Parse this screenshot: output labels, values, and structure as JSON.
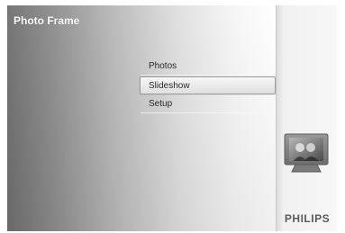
{
  "app": {
    "title": "Photo Frame"
  },
  "menu": {
    "items": [
      {
        "label": "Photos",
        "selected": false
      },
      {
        "label": "Slideshow",
        "selected": true
      },
      {
        "label": "Setup",
        "selected": false
      }
    ]
  },
  "side_panel": {
    "icon": "photo-frame-icon",
    "brand": "PHILIPS"
  },
  "colors": {
    "background": "#000000",
    "selection_border": "#9a9a9a",
    "title_text": "#ffffff",
    "brand_text": "#5a5a5a"
  }
}
